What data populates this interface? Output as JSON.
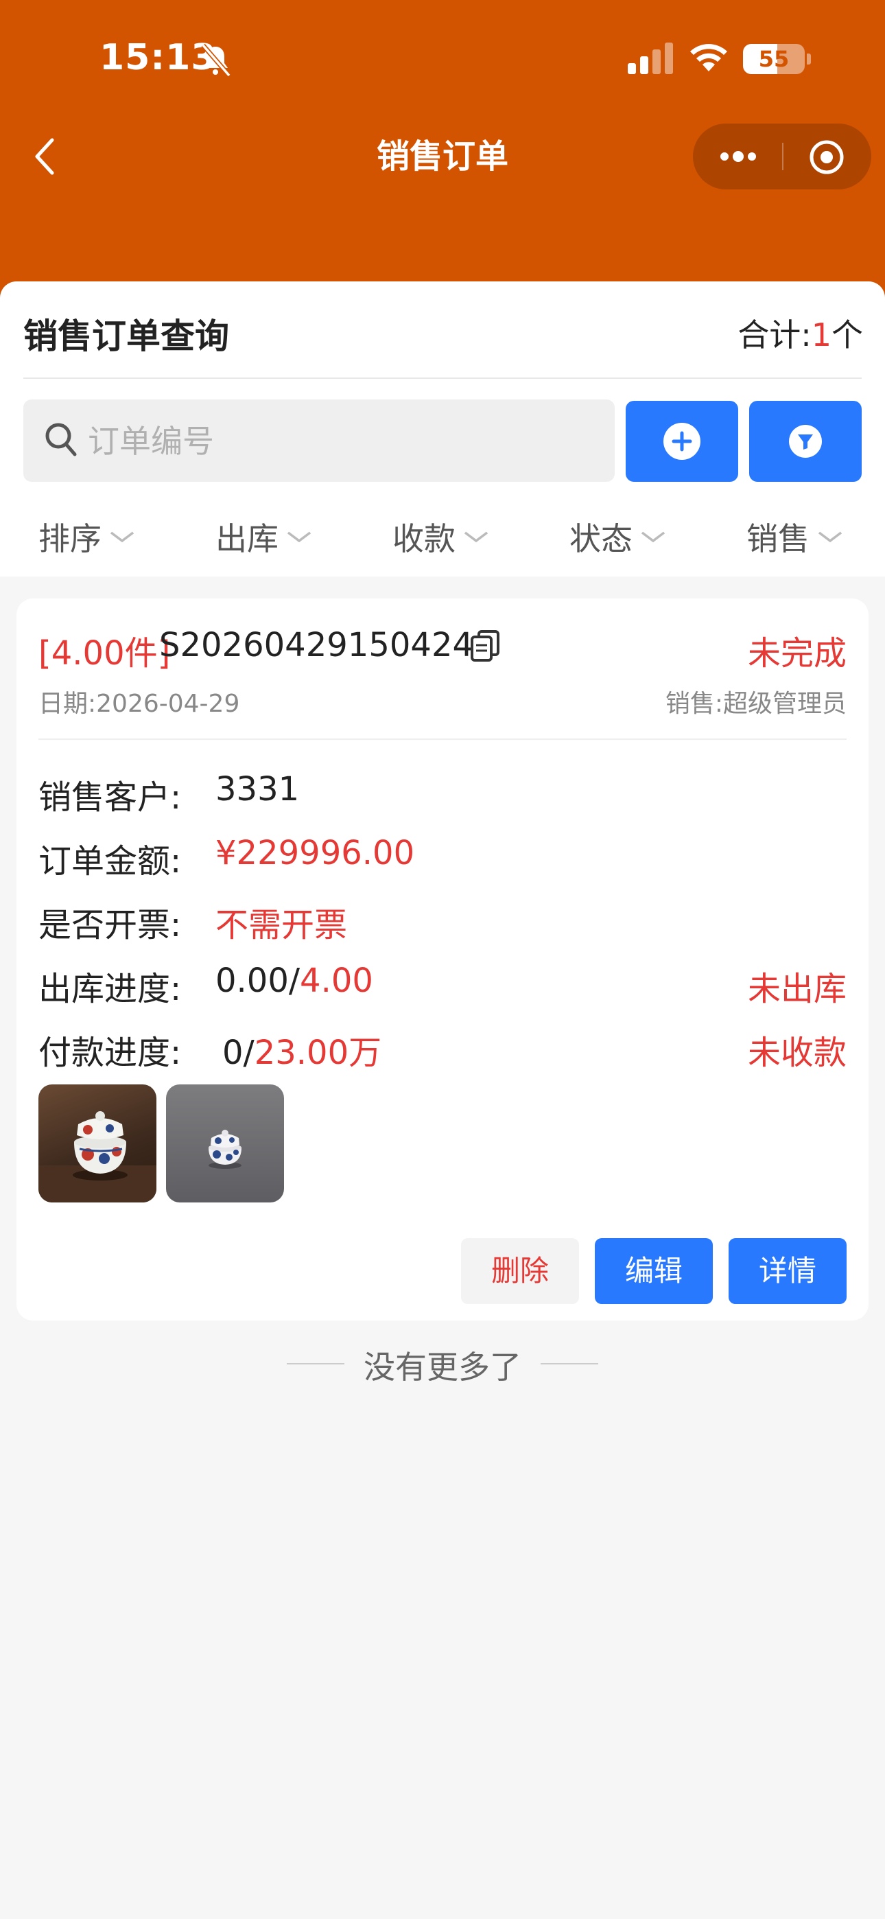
{
  "status_bar": {
    "time": "15:13",
    "battery": "55",
    "battery_level": 0.55
  },
  "nav": {
    "title": "销售订单"
  },
  "query": {
    "title": "销售订单查询",
    "total_prefix": "合计:",
    "total_count": "1",
    "total_suffix": "个",
    "search_placeholder": "订单编号",
    "filters": [
      "排序",
      "出库",
      "收款",
      "状态",
      "销售"
    ]
  },
  "order": {
    "qty_tag": "[4.00件]",
    "order_no": "S20260429150424",
    "status": "未完成",
    "date": "日期:2026-04-29",
    "sales": "销售:超级管理员",
    "customer_label": "销售客户:",
    "customer_value": "3331",
    "amount_label": "订单金额:",
    "amount_value": "¥229996.00",
    "invoice_label": "是否开票:",
    "invoice_value": "不需开票",
    "ship_label": "出库进度:",
    "ship_done": "0.00/",
    "ship_total": "4.00",
    "ship_status": "未出库",
    "pay_label": "付款进度:",
    "pay_done": "0/",
    "pay_total": "23.00万",
    "pay_status": "未收款",
    "buttons": {
      "delete": "删除",
      "edit": "编辑",
      "detail": "详情"
    }
  },
  "footer": {
    "no_more": "没有更多了"
  },
  "colors": {
    "header": "#d35400",
    "accent_blue": "#2979ff",
    "accent_red": "#e53935"
  }
}
